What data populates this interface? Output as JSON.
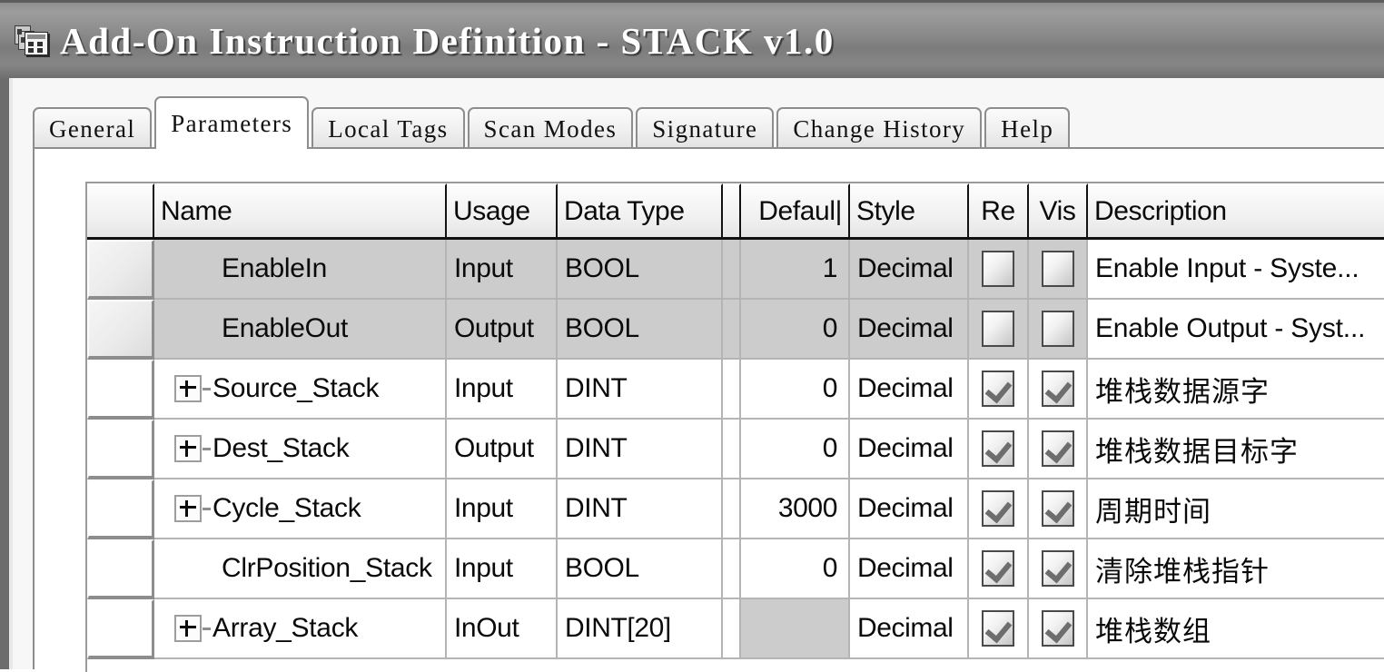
{
  "window": {
    "title": "Add-On Instruction Definition - STACK v1.0",
    "icon": "add-on-instruction-icon"
  },
  "tabs": [
    {
      "label": "General",
      "active": false
    },
    {
      "label": "Parameters",
      "active": true
    },
    {
      "label": "Local Tags",
      "active": false
    },
    {
      "label": "Scan Modes",
      "active": false
    },
    {
      "label": "Signature",
      "active": false
    },
    {
      "label": "Change History",
      "active": false
    },
    {
      "label": "Help",
      "active": false
    }
  ],
  "grid": {
    "columns": [
      {
        "key": "selector",
        "label": ""
      },
      {
        "key": "name",
        "label": "Name"
      },
      {
        "key": "usage",
        "label": "Usage"
      },
      {
        "key": "data_type",
        "label": "Data Type"
      },
      {
        "key": "gap",
        "label": ""
      },
      {
        "key": "default",
        "label": "Defaul|"
      },
      {
        "key": "style",
        "label": "Style"
      },
      {
        "key": "req",
        "label": "Re"
      },
      {
        "key": "vis",
        "label": "Vis"
      },
      {
        "key": "description",
        "label": "Description"
      }
    ],
    "rows": [
      {
        "name": "EnableIn",
        "expandable": false,
        "usage": "Input",
        "data_type": "BOOL",
        "default": "1",
        "style": "Decimal",
        "req": false,
        "vis": false,
        "description": "Enable Input - Syste...",
        "system": true
      },
      {
        "name": "EnableOut",
        "expandable": false,
        "usage": "Output",
        "data_type": "BOOL",
        "default": "0",
        "style": "Decimal",
        "req": false,
        "vis": false,
        "description": "Enable Output - Syst...",
        "system": true
      },
      {
        "name": "Source_Stack",
        "expandable": true,
        "usage": "Input",
        "data_type": "DINT",
        "default": "0",
        "style": "Decimal",
        "req": true,
        "vis": true,
        "description": "堆栈数据源字",
        "system": false
      },
      {
        "name": "Dest_Stack",
        "expandable": true,
        "usage": "Output",
        "data_type": "DINT",
        "default": "0",
        "style": "Decimal",
        "req": true,
        "vis": true,
        "description": "堆栈数据目标字",
        "system": false
      },
      {
        "name": "Cycle_Stack",
        "expandable": true,
        "usage": "Input",
        "data_type": "DINT",
        "default": "3000",
        "style": "Decimal",
        "req": true,
        "vis": true,
        "description": "周期时间",
        "system": false
      },
      {
        "name": "ClrPosition_Stack",
        "expandable": false,
        "usage": "Input",
        "data_type": "BOOL",
        "default": "0",
        "style": "Decimal",
        "req": true,
        "vis": true,
        "description": "清除堆栈指针",
        "system": false
      },
      {
        "name": "Array_Stack",
        "expandable": true,
        "usage": "InOut",
        "data_type": "DINT[20]",
        "default": "",
        "style": "Decimal",
        "req": true,
        "vis": true,
        "description": "堆栈数组",
        "system": false
      }
    ]
  },
  "colors": {
    "titlebar": "#8a8a8a",
    "system_row": "#cccccc",
    "vis_column": "#cccccc",
    "grid_line": "#b4b4b4",
    "text": "#0a0a0a"
  }
}
